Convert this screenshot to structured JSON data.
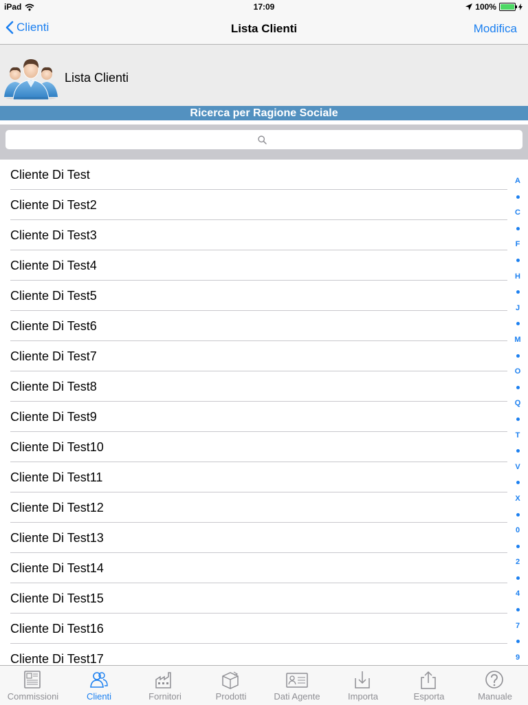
{
  "status": {
    "device": "iPad",
    "time": "17:09",
    "battery": "100%",
    "battery_level": 1.0
  },
  "nav": {
    "back_label": "Clienti",
    "title": "Lista Clienti",
    "edit_label": "Modifica"
  },
  "header": {
    "title": "Lista Clienti",
    "banner": "Ricerca per Ragione Sociale"
  },
  "search": {
    "placeholder": ""
  },
  "clients": [
    "Cliente Di Test",
    "Cliente Di Test2",
    "Cliente Di Test3",
    "Cliente Di Test4",
    "Cliente Di Test5",
    "Cliente Di Test6",
    "Cliente Di Test7",
    "Cliente Di Test8",
    "Cliente Di Test9",
    "Cliente Di Test10",
    "Cliente Di Test11",
    "Cliente Di Test12",
    "Cliente Di Test13",
    "Cliente Di Test14",
    "Cliente Di Test15",
    "Cliente Di Test16",
    "Cliente Di Test17"
  ],
  "index": [
    "A",
    "•",
    "C",
    "•",
    "F",
    "•",
    "H",
    "•",
    "J",
    "•",
    "M",
    "•",
    "O",
    "•",
    "Q",
    "•",
    "T",
    "•",
    "V",
    "•",
    "X",
    "•",
    "0",
    "•",
    "2",
    "•",
    "4",
    "•",
    "7",
    "•",
    "9"
  ],
  "tabs": [
    {
      "label": "Commissioni",
      "icon": "ledger-icon",
      "active": false
    },
    {
      "label": "Clienti",
      "icon": "people-icon",
      "active": true
    },
    {
      "label": "Fornitori",
      "icon": "factory-icon",
      "active": false
    },
    {
      "label": "Prodotti",
      "icon": "box-icon",
      "active": false
    },
    {
      "label": "Dati Agente",
      "icon": "id-card-icon",
      "active": false
    },
    {
      "label": "Importa",
      "icon": "download-icon",
      "active": false
    },
    {
      "label": "Esporta",
      "icon": "share-icon",
      "active": false
    },
    {
      "label": "Manuale",
      "icon": "help-icon",
      "active": false
    }
  ],
  "colors": {
    "accent": "#1a7ff0",
    "banner": "#5391c0"
  }
}
